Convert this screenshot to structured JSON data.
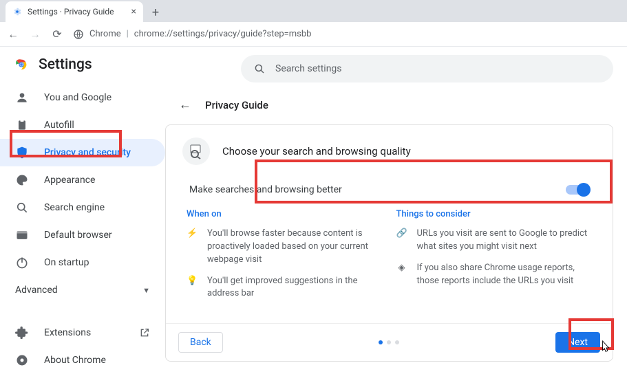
{
  "browser": {
    "tab_title": "Settings · Privacy Guide",
    "url_host": "Chrome",
    "url_path": "chrome://settings/privacy/guide?step=msbb"
  },
  "brand": {
    "title": "Settings"
  },
  "search": {
    "placeholder": "Search settings"
  },
  "sidebar": {
    "items": [
      {
        "label": "You and Google"
      },
      {
        "label": "Autofill"
      },
      {
        "label": "Privacy and security"
      },
      {
        "label": "Appearance"
      },
      {
        "label": "Search engine"
      },
      {
        "label": "Default browser"
      },
      {
        "label": "On startup"
      }
    ],
    "advanced_label": "Advanced",
    "extensions_label": "Extensions",
    "about_label": "About Chrome"
  },
  "crumb": {
    "title": "Privacy Guide"
  },
  "card": {
    "title": "Choose your search and browsing quality",
    "setting_label": "Make searches and browsing better",
    "when_on_header": "When on",
    "when_on": [
      "You'll browse faster because content is proactively loaded based on your current webpage visit",
      "You'll get improved suggestions in the address bar"
    ],
    "consider_header": "Things to consider",
    "consider": [
      "URLs you visit are sent to Google to predict what sites you might visit next",
      "If you also share Chrome usage reports, those reports include the URLs you visit"
    ],
    "back_label": "Back",
    "next_label": "Next"
  }
}
